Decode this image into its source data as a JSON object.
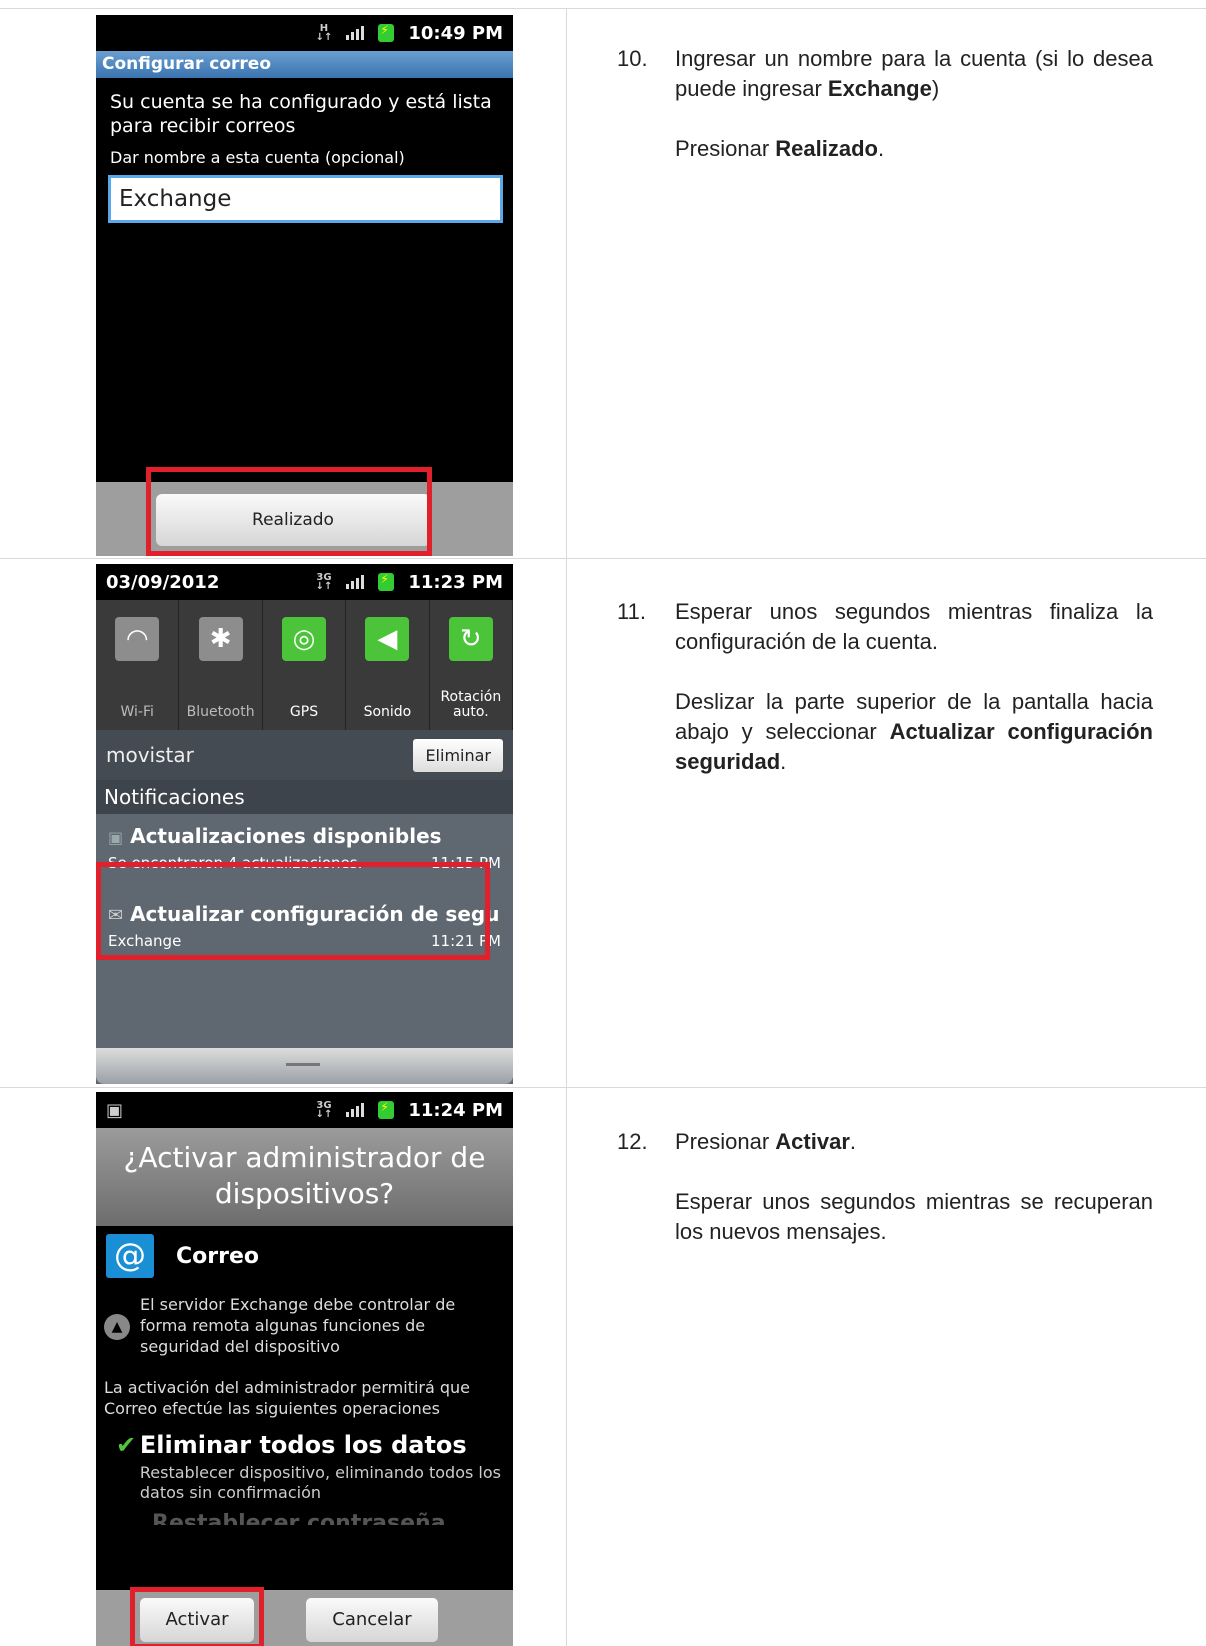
{
  "phone1": {
    "time": "10:49 PM",
    "title": "Configurar correo",
    "message": "Su cuenta se ha configurado y está lista para recibir correos",
    "field_label": "Dar nombre a esta cuenta (opcional)",
    "field_value": "Exchange",
    "button": "Realizado"
  },
  "phone2": {
    "date": "03/09/2012",
    "time": "11:23 PM",
    "quick": [
      "Wi-Fi",
      "Bluetooth",
      "GPS",
      "Sonido",
      "Rotación auto."
    ],
    "carrier": "movistar",
    "delete_button": "Eliminar",
    "notifications_header": "Notificaciones",
    "notif1_title": "Actualizaciones disponibles",
    "notif1_sub": "Se encontraron 4 actualizaciones.",
    "notif1_time": "11:15 PM",
    "notif2_title": "Actualizar configuración de seguri",
    "notif2_sub": "Exchange",
    "notif2_time": "11:21 PM"
  },
  "phone3": {
    "time": "11:24 PM",
    "title_line1": "¿Activar administrador de",
    "title_line2": "dispositivos?",
    "app_name": "Correo",
    "desc": "El servidor Exchange debe controlar de forma remota algunas funciones de seguridad del dispositivo",
    "activation_text": "La activación del administrador permitirá que Correo efectúe las siguientes operaciones",
    "perm_title": "Eliminar todos los datos",
    "perm_desc": "Restablecer dispositivo, eliminando todos los datos sin confirmación",
    "perm2_partial": "Restablecer contraseña",
    "activate": "Activar",
    "cancel": "Cancelar"
  },
  "steps": {
    "s10_num": "10.",
    "s10_a": "Ingresar un nombre para la cuenta (si lo desea puede ingresar ",
    "s10_b": "Exchange",
    "s10_c": ")",
    "s10_d": "Presionar ",
    "s10_e": "Realizado",
    "s10_f": ".",
    "s11_num": "11.",
    "s11_a": "Esperar unos segundos mientras finaliza la configuración de la cuenta.",
    "s11_b": "Deslizar la parte superior de la pantalla hacia abajo y seleccionar ",
    "s11_c": "Actualizar configuración seguridad",
    "s11_d": ".",
    "s12_num": "12.",
    "s12_a": "Presionar ",
    "s12_b": "Activar",
    "s12_c": ".",
    "s12_d": "Esperar unos segundos mientras se recuperan los nuevos mensajes."
  }
}
